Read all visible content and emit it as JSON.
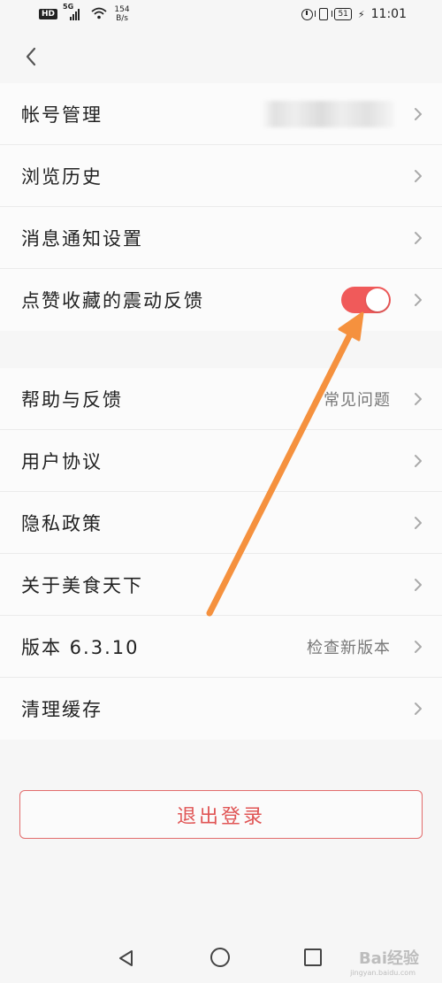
{
  "status_bar": {
    "network_badge": "HD",
    "signal_gen": "5G",
    "net_speed_value": "154",
    "net_speed_unit": "B/s",
    "battery": "51",
    "time": "11:01"
  },
  "settings_group_1": [
    {
      "label": "帐号管理",
      "value": "",
      "has_blurred_value": true
    },
    {
      "label": "浏览历史",
      "value": ""
    },
    {
      "label": "消息通知设置",
      "value": ""
    },
    {
      "label": "点赞收藏的震动反馈",
      "value": "",
      "toggle_on": true
    }
  ],
  "settings_group_2": [
    {
      "label": "帮助与反馈",
      "value": "常见问题"
    },
    {
      "label": "用户协议",
      "value": ""
    },
    {
      "label": "隐私政策",
      "value": ""
    },
    {
      "label": "关于美食天下",
      "value": ""
    },
    {
      "label": "版本 6.3.10",
      "value": "检查新版本"
    },
    {
      "label": "清理缓存",
      "value": ""
    }
  ],
  "logout_label": "退出登录",
  "watermark": {
    "text": "Bai经验",
    "sub": "jingyan.baidu.com"
  },
  "colors": {
    "toggle_on": "#f05a5a",
    "logout_text": "#e05555",
    "annotation_arrow": "#f5913e"
  },
  "icons": {
    "back": "chevron-left-icon",
    "row_arrow": "chevron-right-icon",
    "nav": [
      "triangle-back-icon",
      "circle-home-icon",
      "square-recent-icon"
    ]
  }
}
